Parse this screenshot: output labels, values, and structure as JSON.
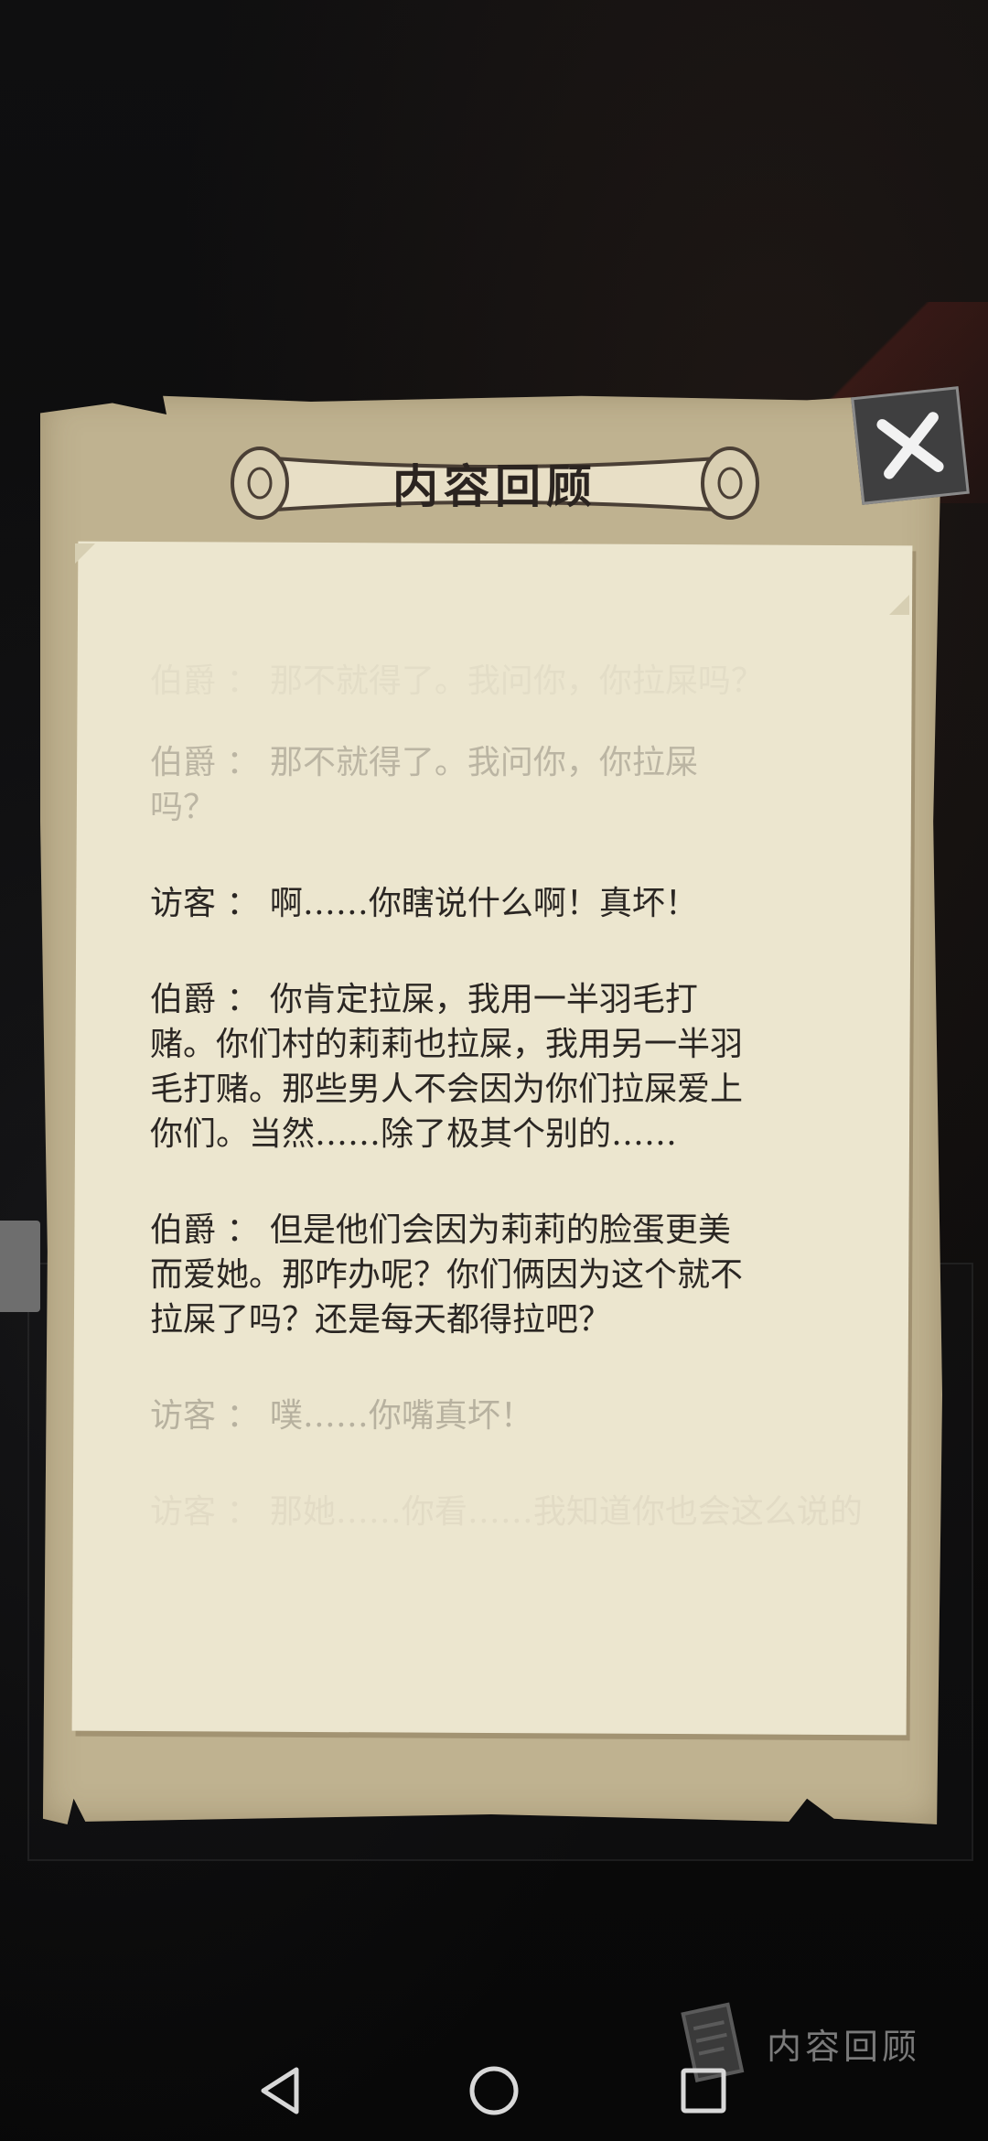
{
  "dialog": {
    "title": "内容回顾",
    "close_icon": "close-x-icon"
  },
  "dialogue": [
    {
      "speaker": "",
      "text": "伯爵 ： 那不就得了。我问你，你拉屎吗？"
    },
    {
      "speaker": "伯爵",
      "text": "伯爵 ： 那不就得了。我问你，你拉屎\n吗？"
    },
    {
      "speaker": "访客",
      "text": "访客 ： 啊……你瞎说什么啊！真坏！"
    },
    {
      "speaker": "伯爵",
      "text": "伯爵 ： 你肯定拉屎，我用一半羽毛打\n赌。你们村的莉莉也拉屎，我用另一半羽\n毛打赌。那些男人不会因为你们拉屎爱上\n你们。当然……除了极其个别的……"
    },
    {
      "speaker": "伯爵",
      "text": "伯爵 ： 但是他们会因为莉莉的脸蛋更美\n而爱她。那咋办呢？你们俩因为这个就不\n拉屎了吗？还是每天都得拉吧？"
    },
    {
      "speaker": "访客",
      "text": "访客 ： 噗……你嘴真坏！"
    },
    {
      "speaker": "",
      "text": "访客 ： 那她……你看……我知道你也会这么说的"
    }
  ],
  "review_button": {
    "label": "内容回顾",
    "icon": "scroll-note-icon"
  },
  "nav": {
    "back_icon": "back-triangle-icon",
    "home_icon": "home-circle-icon",
    "recents_icon": "recents-square-icon"
  }
}
